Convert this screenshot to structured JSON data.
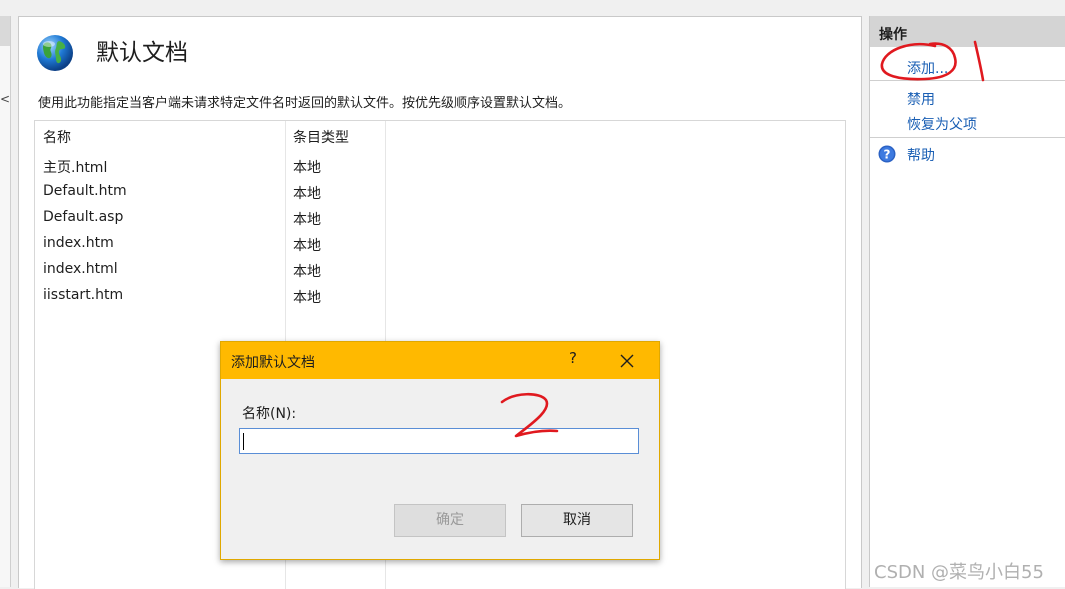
{
  "page": {
    "title": "默认文档",
    "description": "使用此功能指定当客户端未请求特定文件名时返回的默认文件。按优先级顺序设置默认文档。",
    "icon": "globe-icon"
  },
  "left_panel": {
    "close_glyph": "<"
  },
  "list": {
    "columns": [
      "名称",
      "条目类型"
    ],
    "rows": [
      {
        "name": "主页.html",
        "type": "本地"
      },
      {
        "name": "Default.htm",
        "type": "本地"
      },
      {
        "name": "Default.asp",
        "type": "本地"
      },
      {
        "name": "index.htm",
        "type": "本地"
      },
      {
        "name": "index.html",
        "type": "本地"
      },
      {
        "name": "iisstart.htm",
        "type": "本地"
      }
    ]
  },
  "actions": {
    "header": "操作",
    "items": [
      {
        "label": "添加...",
        "icon": null
      },
      {
        "label": "禁用",
        "icon": null
      },
      {
        "label": "恢复为父项",
        "icon": null
      },
      {
        "label": "帮助",
        "icon": "help-icon"
      }
    ]
  },
  "dialog": {
    "title": "添加默认文档",
    "help_glyph": "?",
    "name_label": "名称(N):",
    "name_value": "",
    "ok_label": "确定",
    "cancel_label": "取消"
  },
  "annotations": {
    "mark1": "1",
    "mark2": "2"
  },
  "watermark": "CSDN @菜鸟小白55",
  "colors": {
    "dialog_title_bar": "#ffb900",
    "link": "#1a5fb4",
    "annotation_ink": "#e0191f"
  }
}
